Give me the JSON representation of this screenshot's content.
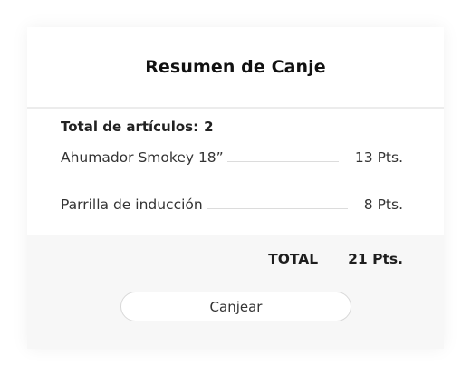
{
  "summary": {
    "title": "Resumen de Canje",
    "count_label": "Total de artículos:",
    "count_value": "2"
  },
  "items": [
    {
      "name": "Ahumador Smokey 18”",
      "points": "13 Pts."
    },
    {
      "name": "Parrilla de inducción",
      "points": "8 Pts."
    }
  ],
  "total": {
    "label": "TOTAL",
    "value": "21 Pts."
  },
  "actions": {
    "redeem_label": "Canjear"
  }
}
